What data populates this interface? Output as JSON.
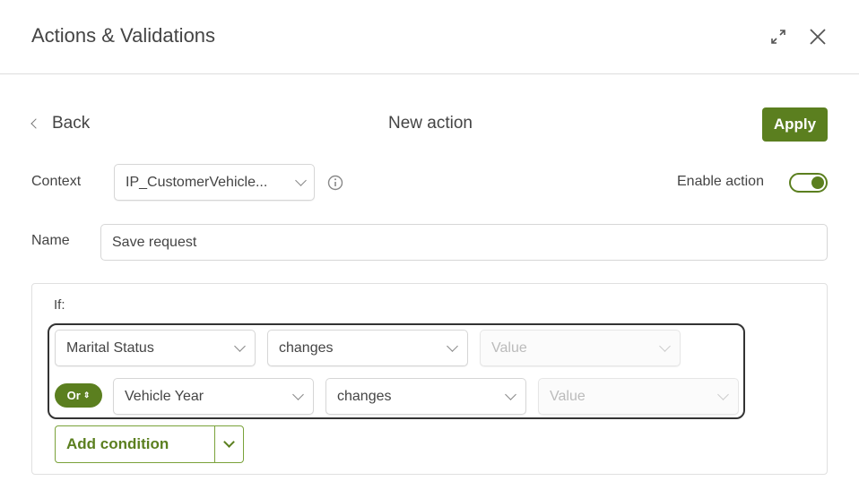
{
  "header": {
    "title": "Actions & Validations",
    "expand_icon": "expand-icon",
    "close_icon": "close-icon"
  },
  "nav": {
    "back_label": "Back",
    "page_title": "New action",
    "apply_label": "Apply"
  },
  "form": {
    "context_label": "Context",
    "context_value": "IP_CustomerVehicle...",
    "enable_label": "Enable action",
    "enable_on": true,
    "name_label": "Name",
    "name_value": "Save request"
  },
  "conditions": {
    "if_label": "If:",
    "rows": [
      {
        "field": "Marital Status",
        "operator": "changes",
        "value_placeholder": "Value"
      },
      {
        "connector": "Or",
        "field": "Vehicle Year",
        "operator": "changes",
        "value_placeholder": "Value"
      }
    ],
    "add_label": "Add condition"
  },
  "colors": {
    "accent": "#5b7f1f"
  }
}
